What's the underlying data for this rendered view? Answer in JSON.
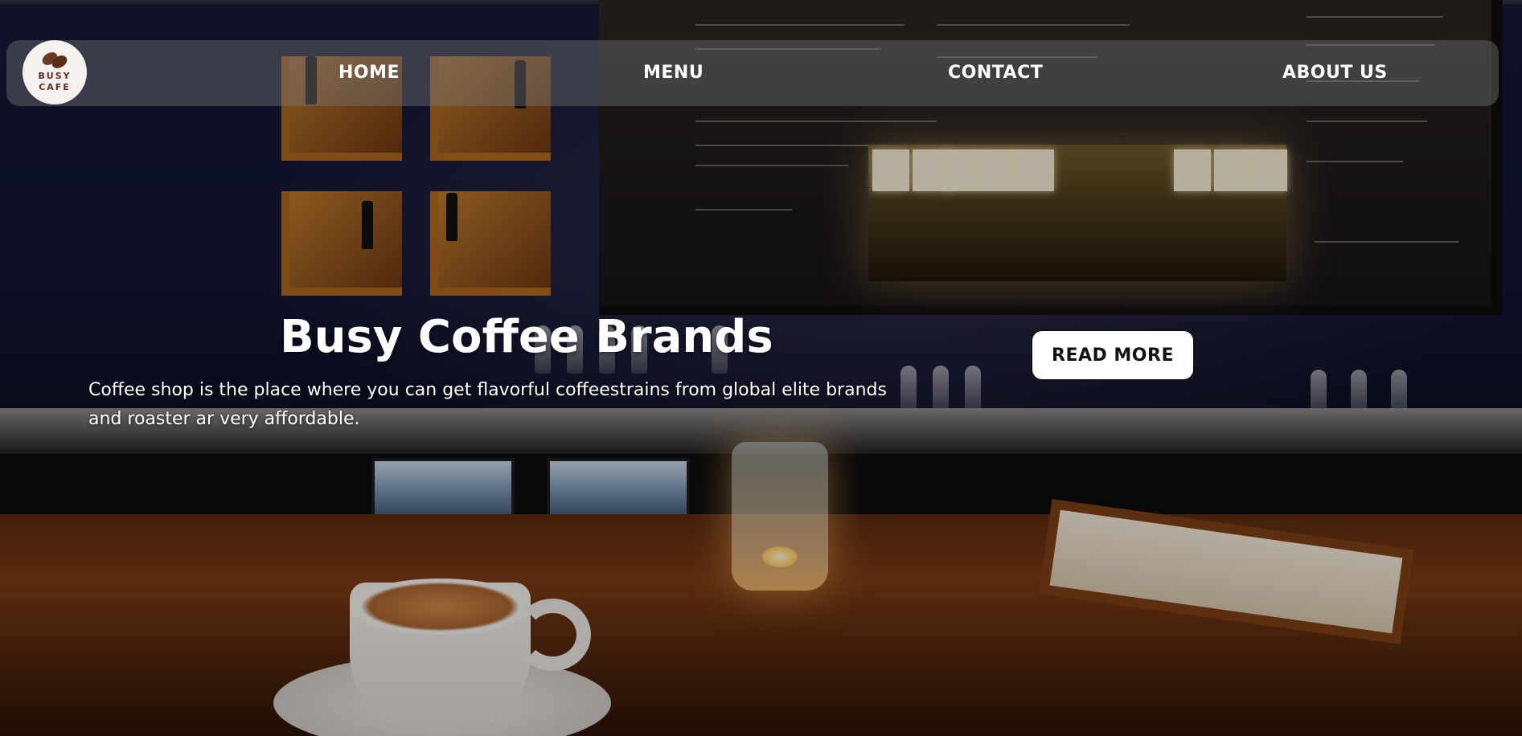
{
  "logo": {
    "line1": "BUSY",
    "line2": "CAFE"
  },
  "nav": {
    "items": [
      {
        "label": "HOME"
      },
      {
        "label": "MENU"
      },
      {
        "label": "CONTACT"
      },
      {
        "label": "ABOUT US"
      }
    ]
  },
  "hero": {
    "title": "Busy Coffee Brands",
    "description": "Coffee shop is the place where you can get flavorful coffeestrains from global elite brands and roaster ar very affordable.",
    "button_label": "READ MORE"
  },
  "colors": {
    "nav_text": "#ffffff",
    "button_bg": "#ffffff",
    "button_text": "#111111",
    "logo_brown": "#5a3020"
  }
}
